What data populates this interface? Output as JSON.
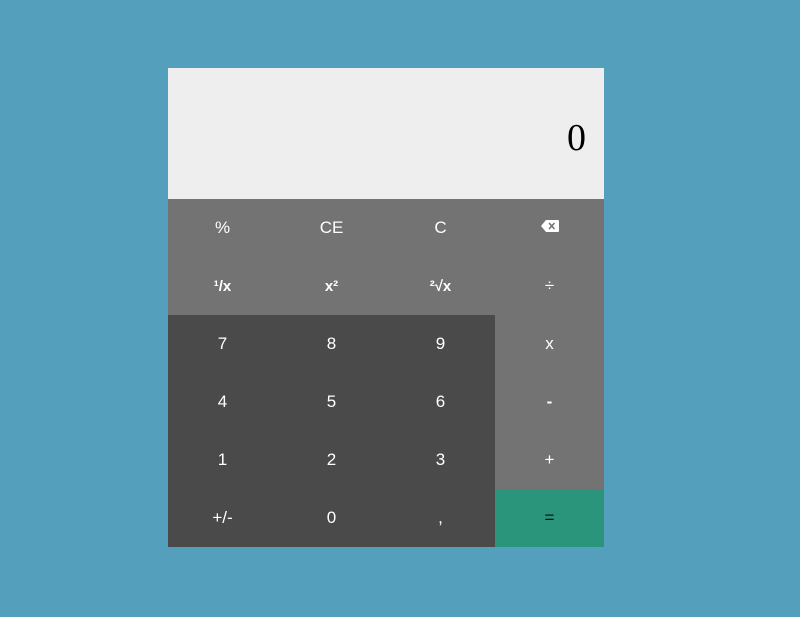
{
  "display": {
    "value": "0"
  },
  "keys": {
    "percent": "%",
    "clear_entry": "CE",
    "clear": "C",
    "reciprocal": "¹/x",
    "square": "x²",
    "sqrt": "²√x",
    "divide": "÷",
    "seven": "7",
    "eight": "8",
    "nine": "9",
    "multiply": "x",
    "four": "4",
    "five": "5",
    "six": "6",
    "minus": "-",
    "one": "1",
    "two": "2",
    "three": "3",
    "plus": "+",
    "negate": "+/-",
    "zero": "0",
    "decimal": ",",
    "equals": "="
  },
  "icons": {
    "backspace": "backspace-icon"
  },
  "colors": {
    "background": "#549fbb",
    "display": "#eeeeee",
    "function_keys": "#737373",
    "number_keys": "#4a4a4a",
    "equals_key": "#2b957b"
  }
}
